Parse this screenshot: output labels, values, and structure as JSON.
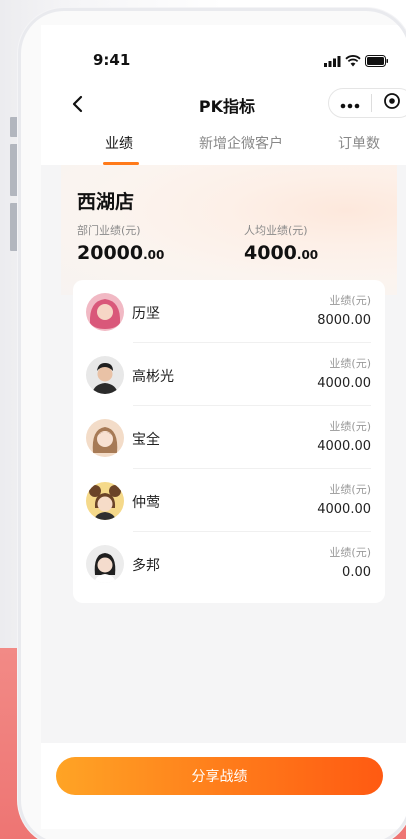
{
  "status": {
    "time": "9:41"
  },
  "nav": {
    "title": "PK指标"
  },
  "tabs": [
    {
      "label": "业绩",
      "active": true
    },
    {
      "label": "新增企微客户",
      "active": false
    },
    {
      "label": "订单数",
      "active": false
    }
  ],
  "store": {
    "name": "西湖店",
    "dept_label": "部门业绩(元)",
    "dept_value_int": "20000",
    "dept_value_dec": ".00",
    "avg_label": "人均业绩(元)",
    "avg_value_int": "4000",
    "avg_value_dec": ".00"
  },
  "rows": [
    {
      "name": "历坚",
      "label": "业绩(元)",
      "value": "8000.00"
    },
    {
      "name": "高彬光",
      "label": "业绩(元)",
      "value": "4000.00"
    },
    {
      "name": "宝全",
      "label": "业绩(元)",
      "value": "4000.00"
    },
    {
      "name": "仲莺",
      "label": "业绩(元)",
      "value": "4000.00"
    },
    {
      "name": "多邦",
      "label": "业绩(元)",
      "value": "0.00"
    }
  ],
  "share": {
    "label": "分享战绩"
  },
  "colors": {
    "accent": "#ff7a1a",
    "background_red": "#ee7573"
  },
  "icons": [
    "back-arrow-icon",
    "more-dots-icon",
    "close-target-icon",
    "signal-icon",
    "wifi-icon",
    "battery-icon"
  ]
}
